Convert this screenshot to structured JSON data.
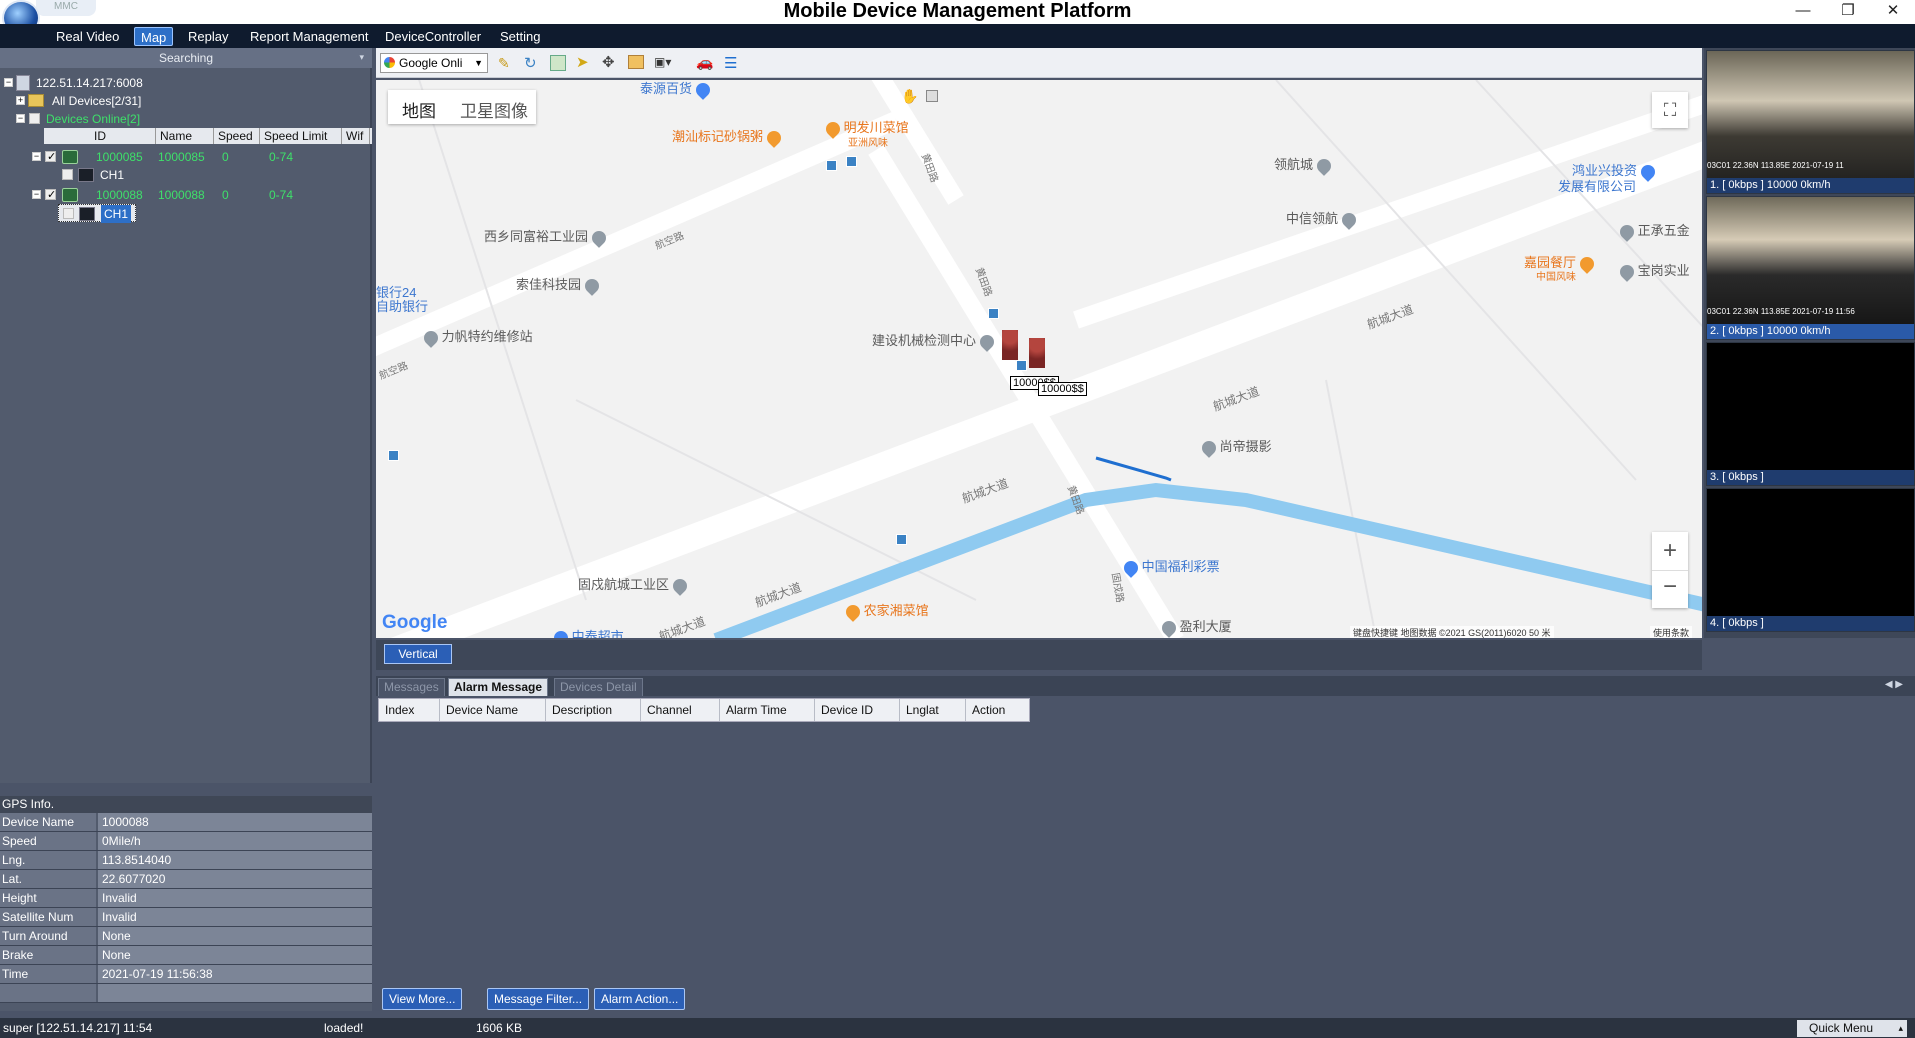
{
  "app": {
    "title": "Mobile Device Management Platform",
    "logo_tab_text": "MMC",
    "window_controls": [
      "—",
      "❐",
      "✕"
    ]
  },
  "menu": {
    "items": [
      "Real Video",
      "Map",
      "Replay",
      "Report Management",
      "DeviceController",
      "Setting"
    ],
    "active": "Map"
  },
  "left": {
    "search_label": "Searching",
    "server": "122.51.14.217:6008",
    "all_devices": "All Devices[2/31]",
    "devices_online": "Devices Online[2]",
    "columns": [
      "ID",
      "Name",
      "Speed",
      "Speed Limit",
      "Wif"
    ],
    "devices": [
      {
        "id": "1000085",
        "name": "1000085",
        "speed": "0",
        "limit": "0-74",
        "channel": "CH1"
      },
      {
        "id": "1000088",
        "name": "1000088",
        "speed": "0",
        "limit": "0-74",
        "channel": "CH1"
      }
    ]
  },
  "gps": {
    "header": "GPS Info.",
    "rows": [
      {
        "k": "Device Name",
        "v": "1000088"
      },
      {
        "k": "Speed",
        "v": "0Mile/h"
      },
      {
        "k": "Lng.",
        "v": "113.8514040"
      },
      {
        "k": "Lat.",
        "v": "22.6077020"
      },
      {
        "k": "Height",
        "v": "Invalid"
      },
      {
        "k": "Satellite Num",
        "v": "Invalid"
      },
      {
        "k": "Turn Around",
        "v": "None"
      },
      {
        "k": "Brake",
        "v": "None"
      },
      {
        "k": "Time",
        "v": "2021-07-19 11:56:38"
      }
    ]
  },
  "map": {
    "provider": "Google Onli",
    "tab_map": "地图",
    "tab_satellite": "卫星图像",
    "google": "Google",
    "attribution": "键盘快捷键   地图数据 ©2021 GS(2011)6020   50 米",
    "terms": "使用条款",
    "vehicle_labels": [
      "10000$$",
      "10000$$"
    ],
    "pois": [
      {
        "text": "泰源百货",
        "type": "blue"
      },
      {
        "text": "潮汕标记砂锅粥",
        "type": "orange"
      },
      {
        "text": "明发川菜馆",
        "type": "orange"
      },
      {
        "text": "亚洲风味",
        "type": "orange"
      },
      {
        "text": "领航城",
        "type": "gray"
      },
      {
        "text": "鸿业兴投资",
        "type": "blue"
      },
      {
        "text": "发展有限公司",
        "type": "blue"
      },
      {
        "text": "中信领航",
        "type": "gray"
      },
      {
        "text": "西乡同富裕工业园",
        "type": "gray"
      },
      {
        "text": "正承五金",
        "type": "gray"
      },
      {
        "text": "嘉园餐厅",
        "type": "orange"
      },
      {
        "text": "中国风味",
        "type": "orange"
      },
      {
        "text": "宝岗实业",
        "type": "gray"
      },
      {
        "text": "索佳科技园",
        "type": "gray"
      },
      {
        "text": "银行24",
        "type": "blue"
      },
      {
        "text": "自助银行",
        "type": "blue"
      },
      {
        "text": "力帆特约维修站",
        "type": "gray"
      },
      {
        "text": "建设机械检测中心",
        "type": "gray"
      },
      {
        "text": "尚帝摄影",
        "type": "gray"
      },
      {
        "text": "中国福利彩票",
        "type": "blue"
      },
      {
        "text": "固戍航城工业区",
        "type": "gray"
      },
      {
        "text": "农家湘菜馆",
        "type": "orange"
      },
      {
        "text": "盈利大厦",
        "type": "gray"
      },
      {
        "text": "中泰超市",
        "type": "blue"
      }
    ],
    "roads": [
      "航城大道",
      "航城大道",
      "航城大道",
      "航城大道",
      "航城大道",
      "航空路",
      "航空路",
      "黄田路",
      "黄田路",
      "黄田路",
      "固戍路"
    ],
    "vertical_btn": "Vertical"
  },
  "cams": [
    {
      "label": "1. [ 0kbps ] 10000 0km/h",
      "overlay": "03C01  22.36N 113.85E  2021-07-19 11"
    },
    {
      "label": "2. [ 0kbps ] 10000 0km/h",
      "overlay": "03C01  22.36N 113.85E  2021-07-19 11:56"
    },
    {
      "label": "3. [ 0kbps ]",
      "overlay": ""
    },
    {
      "label": "4. [ 0kbps ]",
      "overlay": ""
    }
  ],
  "bottom": {
    "tabs": [
      "Messages",
      "Alarm Message",
      "Devices Detail"
    ],
    "active_tab": "Alarm Message",
    "columns": [
      "Index",
      "Device Name",
      "Description",
      "Channel",
      "Alarm Time",
      "Device ID",
      "Lnglat",
      "Action"
    ],
    "buttons": [
      "View More...",
      "Message Filter...",
      "Alarm Action..."
    ]
  },
  "status": {
    "user": "super [122.51.14.217] 11:54",
    "loaded": "loaded!",
    "mem": "1606 KB",
    "quick_menu": "Quick Menu"
  }
}
